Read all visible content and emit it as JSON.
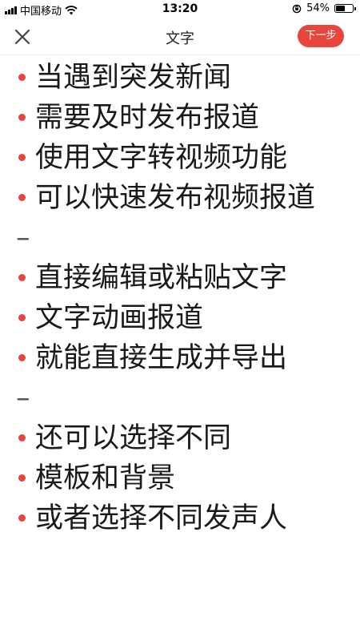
{
  "status_bar": {
    "carrier": "中国移动",
    "time": "13:20",
    "battery": "54%",
    "battery_level": 0.54,
    "icons": [
      "signal-icon",
      "wifi-icon",
      "orientation-lock-icon",
      "battery-icon"
    ]
  },
  "header": {
    "title": "文字",
    "close_icon": "close-icon",
    "next_label": "下一步"
  },
  "colors": {
    "accent": "#e8453c",
    "bullet": "#e8453c",
    "text": "#1a1a1a"
  },
  "lines": [
    {
      "type": "bullet",
      "text": "当遇到突发新闻"
    },
    {
      "type": "bullet",
      "text": "需要及时发布报道"
    },
    {
      "type": "bullet",
      "text": "使用文字转视频功能"
    },
    {
      "type": "bullet",
      "text": "可以快速发布视频报道"
    },
    {
      "type": "separator",
      "text": "–"
    },
    {
      "type": "bullet",
      "text": "直接编辑或粘贴文字"
    },
    {
      "type": "bullet",
      "text": "文字动画报道"
    },
    {
      "type": "bullet",
      "text": "就能直接生成并导出"
    },
    {
      "type": "separator",
      "text": "–"
    },
    {
      "type": "bullet",
      "text": "还可以选择不同"
    },
    {
      "type": "bullet",
      "text": "模板和背景"
    },
    {
      "type": "bullet",
      "text": "或者选择不同发声人"
    }
  ]
}
